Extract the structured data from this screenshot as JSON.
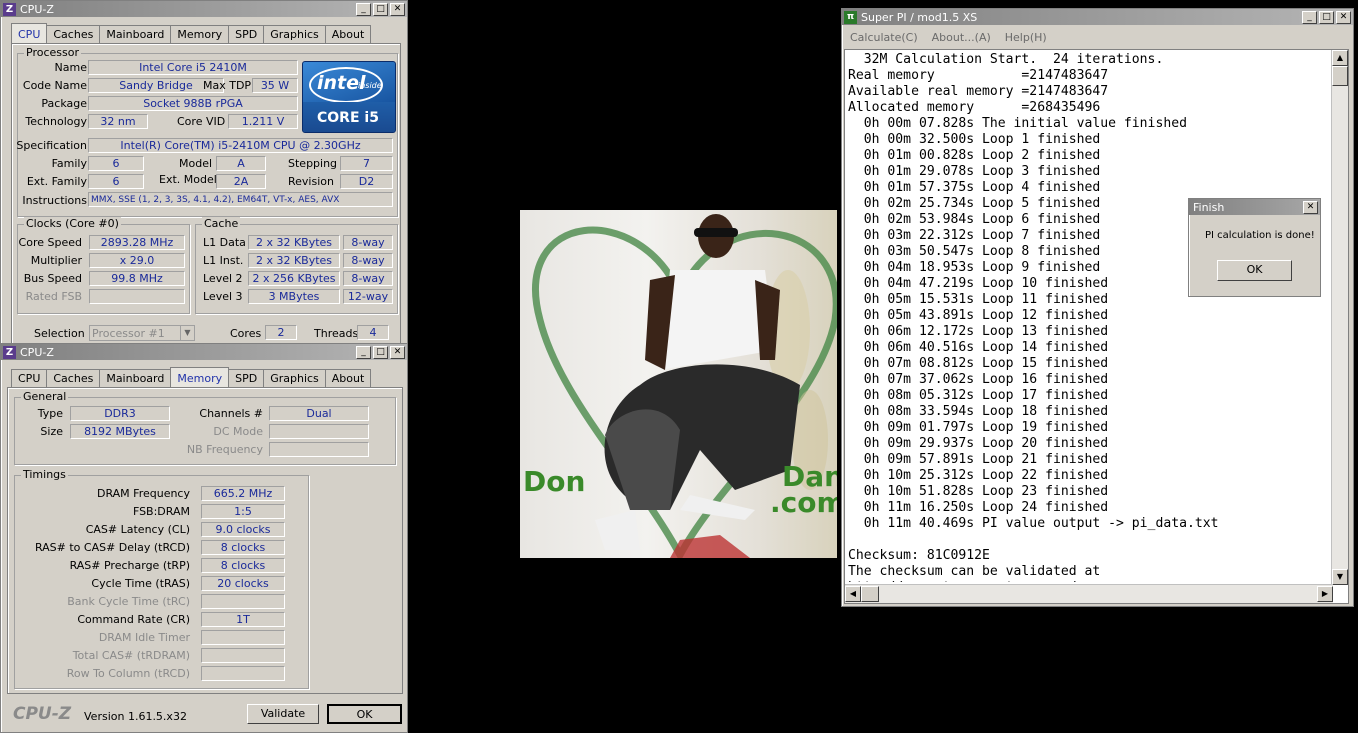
{
  "cpuz1": {
    "title": "CPU-Z",
    "tabs": [
      "CPU",
      "Caches",
      "Mainboard",
      "Memory",
      "SPD",
      "Graphics",
      "About"
    ],
    "processor": {
      "group": "Processor",
      "name_label": "Name",
      "name": "Intel Core i5 2410M",
      "codename_label": "Code Name",
      "codename": "Sandy Bridge",
      "maxtdp_label": "Max TDP",
      "maxtdp": "35 W",
      "package_label": "Package",
      "package": "Socket 988B rPGA",
      "tech_label": "Technology",
      "tech": "32 nm",
      "vid_label": "Core VID",
      "vid": "1.211 V",
      "spec_label": "Specification",
      "spec": "Intel(R) Core(TM) i5-2410M CPU @ 2.30GHz",
      "family_label": "Family",
      "family": "6",
      "model_label": "Model",
      "model": "A",
      "stepping_label": "Stepping",
      "stepping": "7",
      "extfamily_label": "Ext. Family",
      "extfamily": "6",
      "extmodel_label": "Ext. Model",
      "extmodel": "2A",
      "revision_label": "Revision",
      "revision": "D2",
      "instr_label": "Instructions",
      "instr": "MMX, SSE (1, 2, 3, 3S, 4.1, 4.2), EM64T, VT-x, AES, AVX"
    },
    "logo": {
      "brand": "intel",
      "inside": "inside",
      "product": "CORE i5"
    },
    "clocks": {
      "group": "Clocks (Core #0)",
      "corespeed_label": "Core Speed",
      "corespeed": "2893.28 MHz",
      "mult_label": "Multiplier",
      "mult": "x 29.0",
      "bus_label": "Bus Speed",
      "bus": "99.8 MHz",
      "fsb_label": "Rated FSB",
      "fsb": ""
    },
    "cache": {
      "group": "Cache",
      "l1d_label": "L1 Data",
      "l1d": "2 x 32 KBytes",
      "l1d_way": "8-way",
      "l1i_label": "L1 Inst.",
      "l1i": "2 x 32 KBytes",
      "l1i_way": "8-way",
      "l2_label": "Level 2",
      "l2": "2 x 256 KBytes",
      "l2_way": "8-way",
      "l3_label": "Level 3",
      "l3": "3 MBytes",
      "l3_way": "12-way"
    },
    "selection_label": "Selection",
    "selection": "Processor #1",
    "cores_label": "Cores",
    "cores": "2",
    "threads_label": "Threads",
    "threads": "4"
  },
  "cpuz2": {
    "title": "CPU-Z",
    "tabs": [
      "CPU",
      "Caches",
      "Mainboard",
      "Memory",
      "SPD",
      "Graphics",
      "About"
    ],
    "general": {
      "group": "General",
      "type_label": "Type",
      "type": "DDR3",
      "size_label": "Size",
      "size": "8192 MBytes",
      "channels_label": "Channels #",
      "channels": "Dual",
      "dcmode_label": "DC Mode",
      "dcmode": "",
      "nbfreq_label": "NB Frequency",
      "nbfreq": ""
    },
    "timings": {
      "group": "Timings",
      "rows": [
        {
          "label": "DRAM Frequency",
          "value": "665.2 MHz",
          "dim": false
        },
        {
          "label": "FSB:DRAM",
          "value": "1:5",
          "dim": false
        },
        {
          "label": "CAS# Latency (CL)",
          "value": "9.0 clocks",
          "dim": false
        },
        {
          "label": "RAS# to CAS# Delay (tRCD)",
          "value": "8 clocks",
          "dim": false
        },
        {
          "label": "RAS# Precharge (tRP)",
          "value": "8 clocks",
          "dim": false
        },
        {
          "label": "Cycle Time (tRAS)",
          "value": "20 clocks",
          "dim": false
        },
        {
          "label": "Bank Cycle Time (tRC)",
          "value": "",
          "dim": true
        },
        {
          "label": "Command Rate (CR)",
          "value": "1T",
          "dim": false
        },
        {
          "label": "DRAM Idle Timer",
          "value": "",
          "dim": true
        },
        {
          "label": "Total CAS# (tRDRAM)",
          "value": "",
          "dim": true
        },
        {
          "label": "Row To Column (tRCD)",
          "value": "",
          "dim": true
        }
      ]
    },
    "brand": "CPU-Z",
    "version": "Version 1.61.5.x32",
    "validate": "Validate",
    "ok": "OK"
  },
  "photo": {
    "left_text": "Don",
    "right_text": "Dan",
    "right_text2": ".com"
  },
  "superpi": {
    "title": "Super PI / mod1.5 XS",
    "menu": [
      "Calculate(C)",
      "About...(A)",
      "Help(H)"
    ],
    "lines": [
      "  32M Calculation Start.  24 iterations.",
      "Real memory           =2147483647",
      "Available real memory =2147483647",
      "Allocated memory      =268435496",
      "  0h 00m 07.828s The initial value finished",
      "  0h 00m 32.500s Loop 1 finished",
      "  0h 01m 00.828s Loop 2 finished",
      "  0h 01m 29.078s Loop 3 finished",
      "  0h 01m 57.375s Loop 4 finished",
      "  0h 02m 25.734s Loop 5 finished",
      "  0h 02m 53.984s Loop 6 finished",
      "  0h 03m 22.312s Loop 7 finished",
      "  0h 03m 50.547s Loop 8 finished",
      "  0h 04m 18.953s Loop 9 finished",
      "  0h 04m 47.219s Loop 10 finished",
      "  0h 05m 15.531s Loop 11 finished",
      "  0h 05m 43.891s Loop 12 finished",
      "  0h 06m 12.172s Loop 13 finished",
      "  0h 06m 40.516s Loop 14 finished",
      "  0h 07m 08.812s Loop 15 finished",
      "  0h 07m 37.062s Loop 16 finished",
      "  0h 08m 05.312s Loop 17 finished",
      "  0h 08m 33.594s Loop 18 finished",
      "  0h 09m 01.797s Loop 19 finished",
      "  0h 09m 29.937s Loop 20 finished",
      "  0h 09m 57.891s Loop 21 finished",
      "  0h 10m 25.312s Loop 22 finished",
      "  0h 10m 51.828s Loop 23 finished",
      "  0h 11m 16.250s Loop 24 finished",
      "  0h 11m 40.469s PI value output -> pi_data.txt",
      "",
      "Checksum: 81C0912E",
      "The checksum can be validated at",
      "http://www.xtremesystems.org/"
    ]
  },
  "finish": {
    "title": "Finish",
    "message": "PI calculation is done!",
    "ok": "OK"
  }
}
